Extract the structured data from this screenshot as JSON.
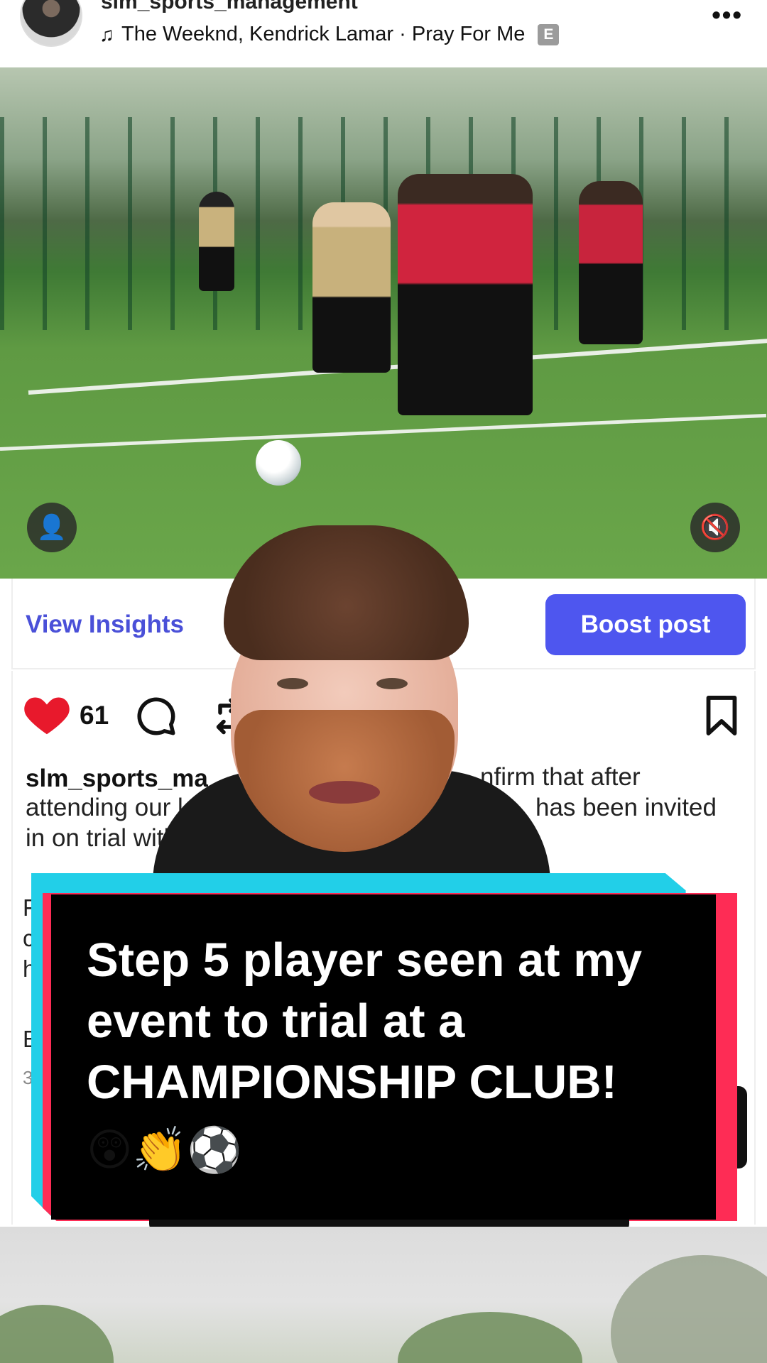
{
  "post_header": {
    "username": "slm_sports_management",
    "music_line": "The Weeknd, Kendrick Lamar · Pray For Me",
    "explicit_badge": "E",
    "more_icon_label": "•••",
    "music_icon": "♫"
  },
  "post_image": {
    "user_tag_icon": "👤",
    "mute_icon": "🔇"
  },
  "insights": {
    "view_insights_label": "View Insights",
    "boost_label": "Boost post"
  },
  "actions": {
    "like_count": "61",
    "heart_color": "#e8192c"
  },
  "caption": {
    "username": "slm_sports_ma",
    "line1_rest": "nfirm that after",
    "line2_start": "attending our l",
    "line2_end": "has been invited",
    "line3": "in on trial with",
    "frag_f": "F",
    "frag_c": "c",
    "frag_h": "h",
    "frag_e": "E",
    "frag_3": "3"
  },
  "overlay": {
    "text": "Step 5 player seen at my event to trial at a CHAMPIONSHIP CLUB!",
    "emojis": "😲👏⚽",
    "colors": {
      "cyan": "#22cfe8",
      "red": "#fe2c55",
      "black": "#000000"
    }
  }
}
